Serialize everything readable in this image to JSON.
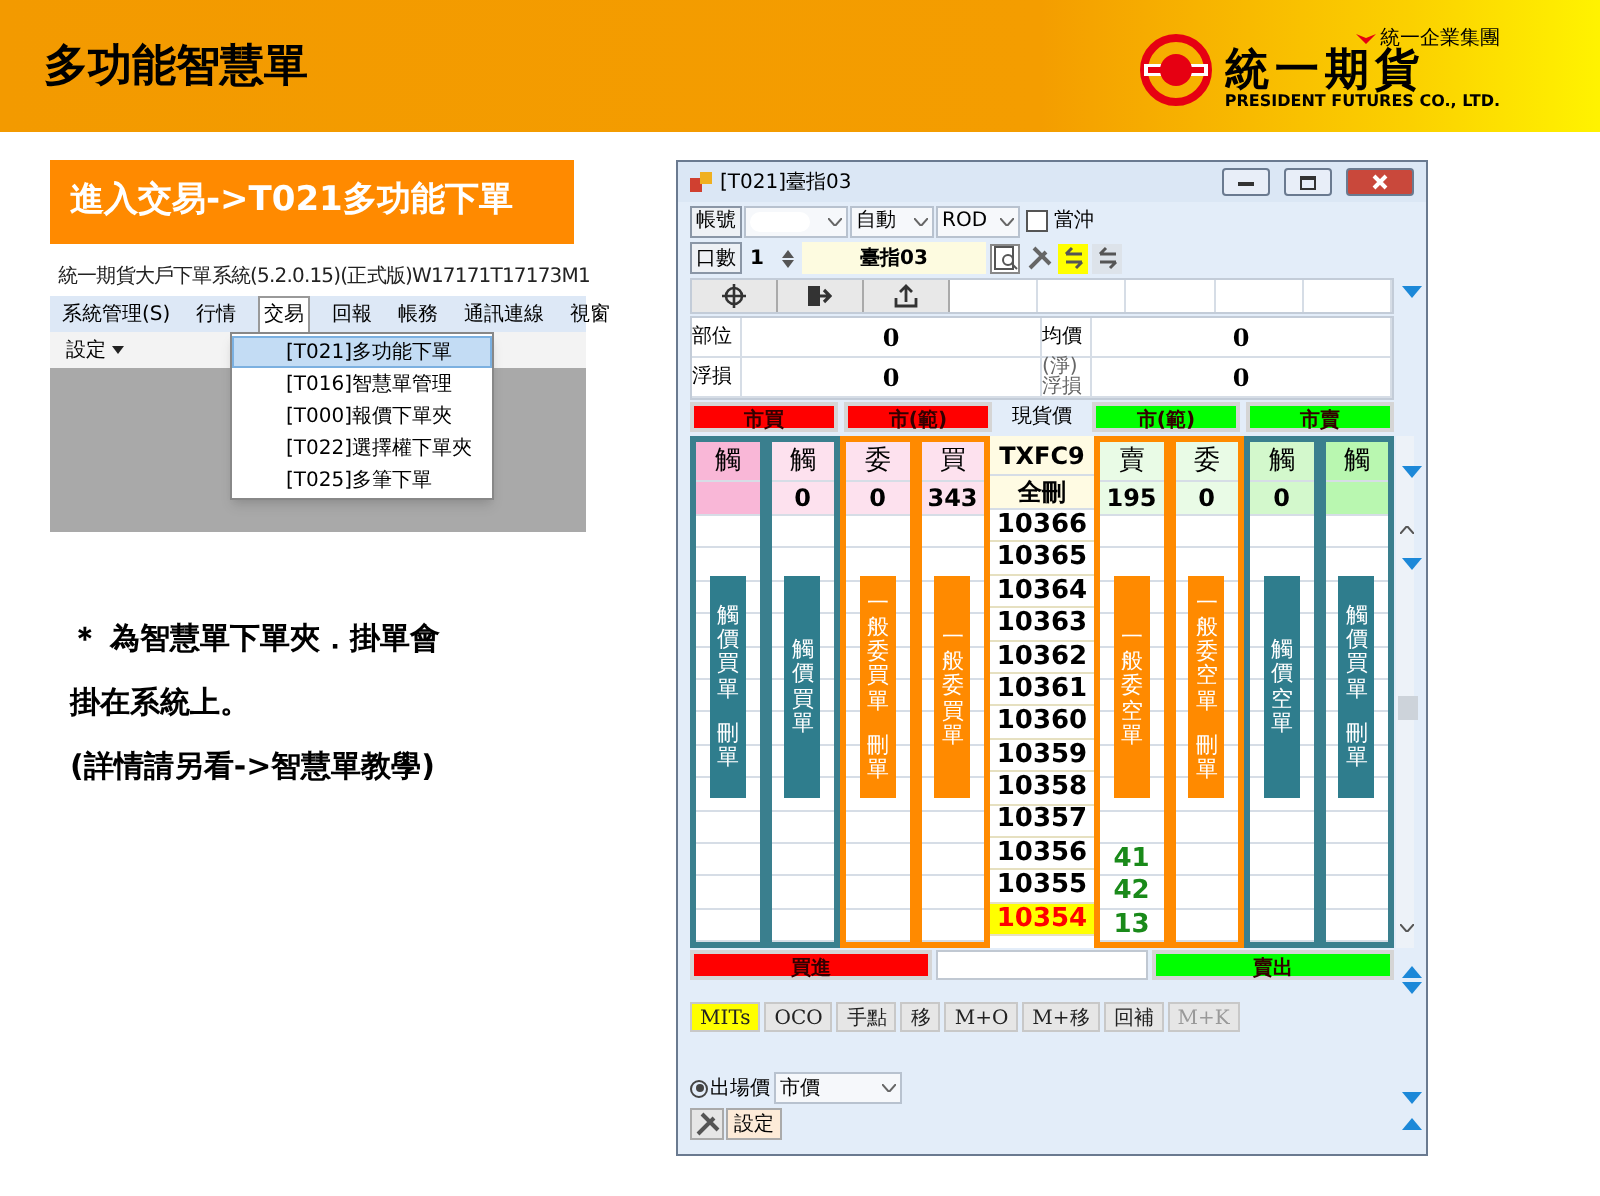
{
  "slide": {
    "title": "多功能智慧單"
  },
  "logo": {
    "tagline": "統一企業集團",
    "name": "統一期貨",
    "english": "PRESIDENT FUTURES CO., LTD."
  },
  "step_banner": "進入交易->T021多功能下單",
  "menu_screenshot": {
    "title": "統一期貨大戶下單系統(5.2.0.15)(正式版)W17171T17173M1",
    "menu": [
      {
        "label": "系統管理(S)",
        "selected": false
      },
      {
        "label": "行情",
        "selected": false
      },
      {
        "label": "交易",
        "selected": true
      },
      {
        "label": "回報",
        "selected": false
      },
      {
        "label": "帳務",
        "selected": false
      },
      {
        "label": "通訊連線",
        "selected": false
      },
      {
        "label": "視窗",
        "selected": false
      }
    ],
    "toolbar_button": "設定",
    "dropdown": [
      {
        "label": "[T021]多功能下單",
        "selected": true
      },
      {
        "label": "[T016]智慧單管理",
        "selected": false
      },
      {
        "label": "[T000]報價下單夾",
        "selected": false
      },
      {
        "label": "[T022]選擇權下單夾",
        "selected": false
      },
      {
        "label": "[T025]多筆下單",
        "selected": false
      }
    ]
  },
  "notes": [
    "＊ 為智慧單下單夾．掛單會",
    "掛在系統上。",
    "(詳情請另看->智慧單教學)"
  ],
  "order_window": {
    "title": "[T021]臺指03",
    "account_label": "帳號",
    "price_mode": "自動",
    "time_in_force": "ROD",
    "day_trade": {
      "label": "當沖",
      "checked": false
    },
    "qty_label": "口數",
    "qty": "1",
    "product": "臺指03",
    "info": [
      {
        "label": "部位",
        "value": "0"
      },
      {
        "label": "均價",
        "value": "0"
      },
      {
        "label": "浮損",
        "value": "0"
      },
      {
        "label": "(淨)浮損",
        "value": "0"
      }
    ],
    "market_buttons": [
      {
        "label": "市買",
        "color": "#ff0000"
      },
      {
        "label": "市(範)",
        "color": "#ff0000"
      },
      {
        "label": "市(範)",
        "color": "#00ff00"
      },
      {
        "label": "市賣",
        "color": "#00ff00"
      }
    ],
    "spot_label": "現貨價",
    "ladder": {
      "columns": [
        {
          "kind": "trigger",
          "header": "觸",
          "color": "#f9b7d7",
          "bar": {
            "label": "觸價買單",
            "cancel": "刪單"
          }
        },
        {
          "kind": "trigger",
          "header": "觸",
          "color": "#fde1ee",
          "total": "0",
          "bar": {
            "label": "觸價買單"
          }
        },
        {
          "kind": "limit",
          "header": "委",
          "color": "#fde1ee",
          "total": "0",
          "bar": {
            "label": "一般委買單",
            "cancel": "刪單"
          }
        },
        {
          "kind": "limit",
          "header": "買",
          "color": "#fde1ee",
          "total": "343",
          "bar": {
            "label": "一般委買單"
          }
        },
        {
          "kind": "price",
          "header": "TXFC9",
          "color": "#fffbe3",
          "total": "全刪"
        },
        {
          "kind": "limit",
          "header": "賣",
          "color": "#e9fbe6",
          "total": "195",
          "bar": {
            "label": "一般委空單"
          }
        },
        {
          "kind": "limit",
          "header": "委",
          "color": "#e9fbe6",
          "total": "0",
          "bar": {
            "label": "一般委空單",
            "cancel": "刪單"
          }
        },
        {
          "kind": "trigger",
          "header": "觸",
          "color": "#d3f8cc",
          "total": "0",
          "bar": {
            "label": "觸價空單"
          }
        },
        {
          "kind": "trigger",
          "header": "觸",
          "color": "#b9f7b0",
          "bar": {
            "label": "觸價買單",
            "cancel": "刪單"
          }
        }
      ],
      "rows": [
        {
          "price": "10366",
          "last": false
        },
        {
          "price": "10365",
          "last": false
        },
        {
          "price": "10364",
          "last": false
        },
        {
          "price": "10363",
          "last": false
        },
        {
          "price": "10362",
          "last": false
        },
        {
          "price": "10361",
          "last": false
        },
        {
          "price": "10360",
          "last": false
        },
        {
          "price": "10359",
          "last": false
        },
        {
          "price": "10358",
          "last": false
        },
        {
          "price": "10357",
          "last": false
        },
        {
          "price": "10356",
          "ask": "41",
          "last": false
        },
        {
          "price": "10355",
          "ask": "42",
          "last": false
        },
        {
          "price": "10354",
          "ask": "13",
          "last": true
        }
      ]
    },
    "order_buttons": [
      {
        "label": "買進",
        "color": "#ff0000"
      },
      {
        "label": "賣出",
        "color": "#00ff00"
      }
    ],
    "strategy_buttons": [
      {
        "label": "MITs",
        "selected": true,
        "disabled": false
      },
      {
        "label": "OCO",
        "selected": false,
        "disabled": false
      },
      {
        "label": "手點",
        "selected": false,
        "disabled": false
      },
      {
        "label": "移",
        "selected": false,
        "disabled": false
      },
      {
        "label": "M+O",
        "selected": false,
        "disabled": false
      },
      {
        "label": "M+移",
        "selected": false,
        "disabled": false
      },
      {
        "label": "回補",
        "selected": false,
        "disabled": false
      },
      {
        "label": "M+K",
        "selected": false,
        "disabled": true
      }
    ],
    "exit_price": {
      "label": "出場價",
      "selected": true,
      "value": "市價"
    },
    "settings_button": "設定"
  }
}
